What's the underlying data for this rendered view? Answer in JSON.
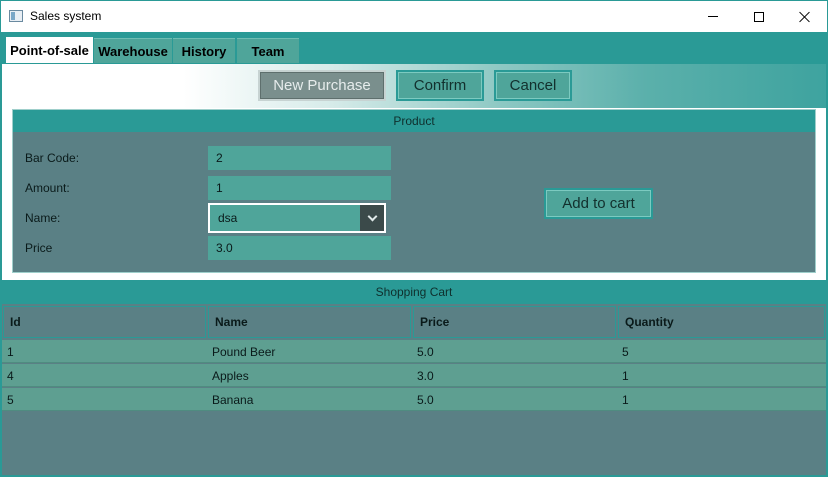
{
  "window": {
    "title": "Sales system"
  },
  "tabs": [
    {
      "label": "Point-of-sale"
    },
    {
      "label": "Warehouse"
    },
    {
      "label": "History"
    },
    {
      "label": "Team"
    }
  ],
  "toolbar": {
    "new_purchase_label": "New Purchase",
    "confirm_label": "Confirm",
    "cancel_label": "Cancel"
  },
  "product": {
    "title": "Product",
    "bar_code_label": "Bar Code:",
    "bar_code_value": "2",
    "amount_label": "Amount:",
    "amount_value": "1",
    "name_label": "Name:",
    "name_value": "dsa",
    "price_label": "Price",
    "price_value": "3.0",
    "add_to_cart_label": "Add to cart"
  },
  "cart": {
    "title": "Shopping Cart",
    "columns": [
      "Id",
      "Name",
      "Price",
      "Quantity"
    ],
    "rows": [
      {
        "id": "1",
        "name": "Pound Beer",
        "price": "5.0",
        "quantity": "5"
      },
      {
        "id": "4",
        "name": "Apples",
        "price": "3.0",
        "quantity": "1"
      },
      {
        "id": "5",
        "name": "Banana",
        "price": "5.0",
        "quantity": "1"
      }
    ]
  }
}
